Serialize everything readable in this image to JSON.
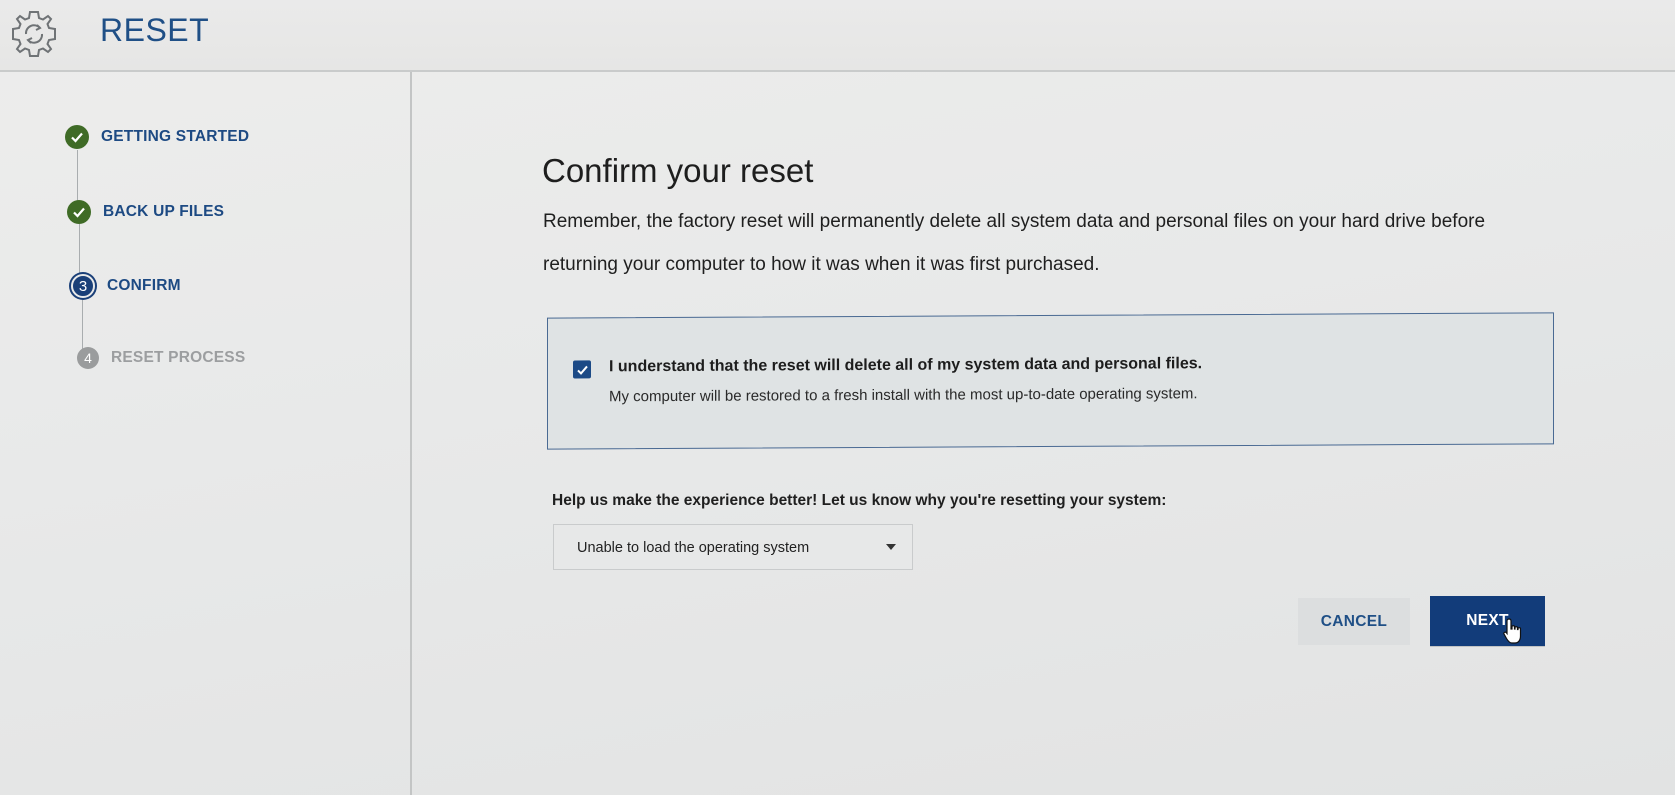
{
  "header": {
    "title": "RESET",
    "icon": "gear-icon"
  },
  "sidebar": {
    "steps": [
      {
        "number": "1",
        "label": "GETTING STARTED",
        "status": "done"
      },
      {
        "number": "2",
        "label": "BACK UP FILES",
        "status": "done"
      },
      {
        "number": "3",
        "label": "CONFIRM",
        "status": "current"
      },
      {
        "number": "4",
        "label": "RESET PROCESS",
        "status": "pending"
      }
    ]
  },
  "main": {
    "title": "Confirm your reset",
    "description": "Remember, the factory reset will permanently delete all system data and personal files on your hard drive before returning your computer to how it was when it was first purchased.",
    "acknowledgement": {
      "checked": true,
      "text": "I understand that the reset will delete all of my system data and personal files.",
      "subtext": "My computer will be restored to a fresh install with the most up-to-date operating system."
    },
    "feedback": {
      "label": "Help us make the experience better! Let us know why you're resetting your system:",
      "selected": "Unable to load the operating system"
    },
    "buttons": {
      "cancel": "CANCEL",
      "next": "NEXT"
    }
  },
  "colors": {
    "accent": "#1c4a86",
    "done": "#3f6b26",
    "pending": "#9a9c9d"
  }
}
